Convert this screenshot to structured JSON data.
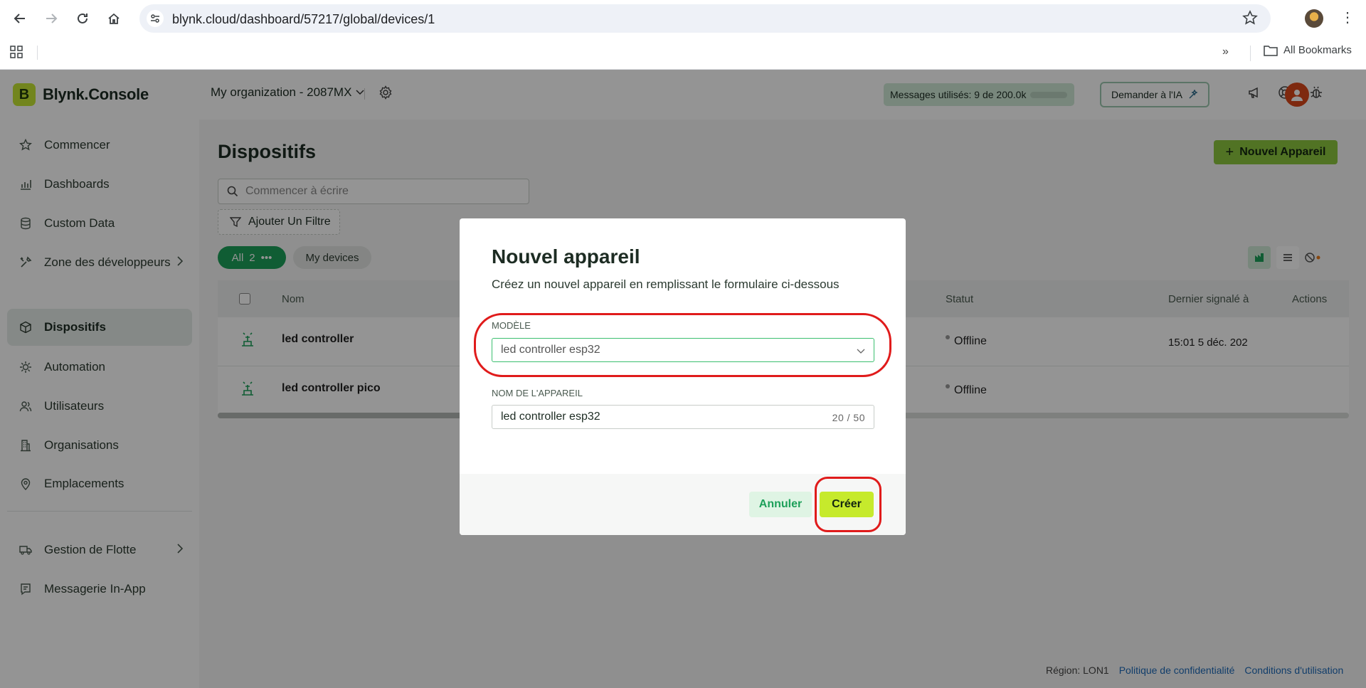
{
  "browser": {
    "url": "blynk.cloud/dashboard/57217/global/devices/1",
    "bookmarks_label": "All Bookmarks"
  },
  "app": {
    "logo_text": "Blynk.Console",
    "logo_letter": "B",
    "org_name": "My organization - 2087MX",
    "messages_text": "Messages utilisés: 9 de 200.0k",
    "ask_ai_label": "Demander à l'IA"
  },
  "sidebar": {
    "items": [
      {
        "label": "Commencer",
        "icon": "star-icon"
      },
      {
        "label": "Dashboards",
        "icon": "chart-icon"
      },
      {
        "label": "Custom Data",
        "icon": "database-icon"
      },
      {
        "label": "Zone des développeurs",
        "icon": "tools-icon"
      },
      {
        "label": "Dispositifs",
        "icon": "cube-icon"
      },
      {
        "label": "Automation",
        "icon": "automation-icon"
      },
      {
        "label": "Utilisateurs",
        "icon": "users-icon"
      },
      {
        "label": "Organisations",
        "icon": "building-icon"
      },
      {
        "label": "Emplacements",
        "icon": "location-pin-icon"
      },
      {
        "label": "Gestion de Flotte",
        "icon": "truck-icon"
      },
      {
        "label": "Messagerie In-App",
        "icon": "message-icon"
      }
    ]
  },
  "main": {
    "title": "Dispositifs",
    "new_device_button": "Nouvel Appareil",
    "search_placeholder": "Commencer à écrire",
    "add_filter_label": "Ajouter Un Filtre",
    "chip_all_label": "All",
    "chip_all_count": "2",
    "chip_my_label": "My devices",
    "columns": {
      "name": "Nom",
      "status": "Statut",
      "last_reported": "Dernier signalé à",
      "actions": "Actions"
    },
    "rows": [
      {
        "name": "led controller",
        "status": "Offline",
        "last_reported": "15:01 5 déc. 202"
      },
      {
        "name": "led controller pico",
        "status": "Offline",
        "last_reported": ""
      }
    ]
  },
  "footer": {
    "region": "Région: LON1",
    "privacy": "Politique de confidentialité",
    "terms": "Conditions d'utilisation"
  },
  "modal": {
    "title": "Nouvel appareil",
    "subtitle": "Créez un nouvel appareil en remplissant le formulaire ci-dessous",
    "template_label": "MODÈLE",
    "template_value": "led controller esp32",
    "name_label": "NOM DE L'APPAREIL",
    "name_value": "led controller esp32",
    "name_counter": "20 / 50",
    "cancel_label": "Annuler",
    "create_label": "Créer"
  },
  "colors": {
    "accent_green": "#1da05a",
    "lime": "#c6ea2c",
    "highlight_red": "#e01b1b"
  }
}
